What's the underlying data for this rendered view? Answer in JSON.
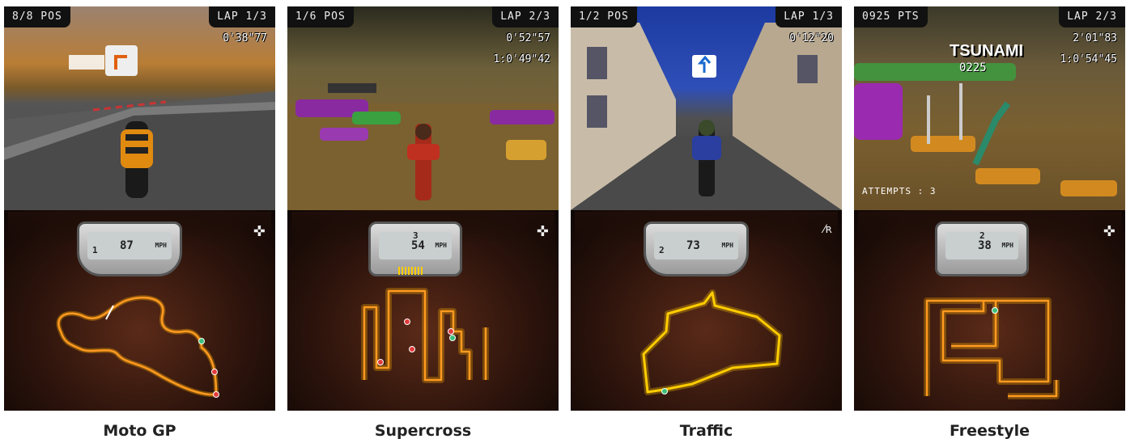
{
  "modes": [
    {
      "id": "motogp",
      "hud_left": "8/8 POS",
      "hud_right": "LAP 1/3",
      "times": [
        "0'38\"77"
      ],
      "gear": "1",
      "speed": "87",
      "unit": "MPH",
      "caption": "Moto GP"
    },
    {
      "id": "supercross",
      "hud_left": "1/6 POS",
      "hud_right": "LAP 2/3",
      "times": [
        "0'52\"57",
        "1:0'49\"42"
      ],
      "gear": "3",
      "speed": "54",
      "unit": "MPH",
      "caption": "Supercross"
    },
    {
      "id": "traffic",
      "hud_left": "1/2 POS",
      "hud_right": "LAP 1/3",
      "times": [
        "0'12\"20"
      ],
      "gear": "2",
      "speed": "73",
      "unit": "MPH",
      "caption": "Traffic"
    },
    {
      "id": "freestyle",
      "hud_left": "0925 PTS",
      "hud_right": "LAP 2/3",
      "times": [
        "2'01\"83",
        "1:0'54\"45"
      ],
      "trick": "TSUNAMI",
      "trick_score": "0225",
      "attempts": "ATTEMPTS : 3",
      "gear": "2",
      "speed": "38",
      "unit": "MPH",
      "caption": "Freestyle"
    }
  ],
  "colors": {
    "track_glow": "#ffcc00",
    "track_core": "#ff9900",
    "marker_red": "#e23b3b",
    "marker_green": "#3bbf7a"
  }
}
